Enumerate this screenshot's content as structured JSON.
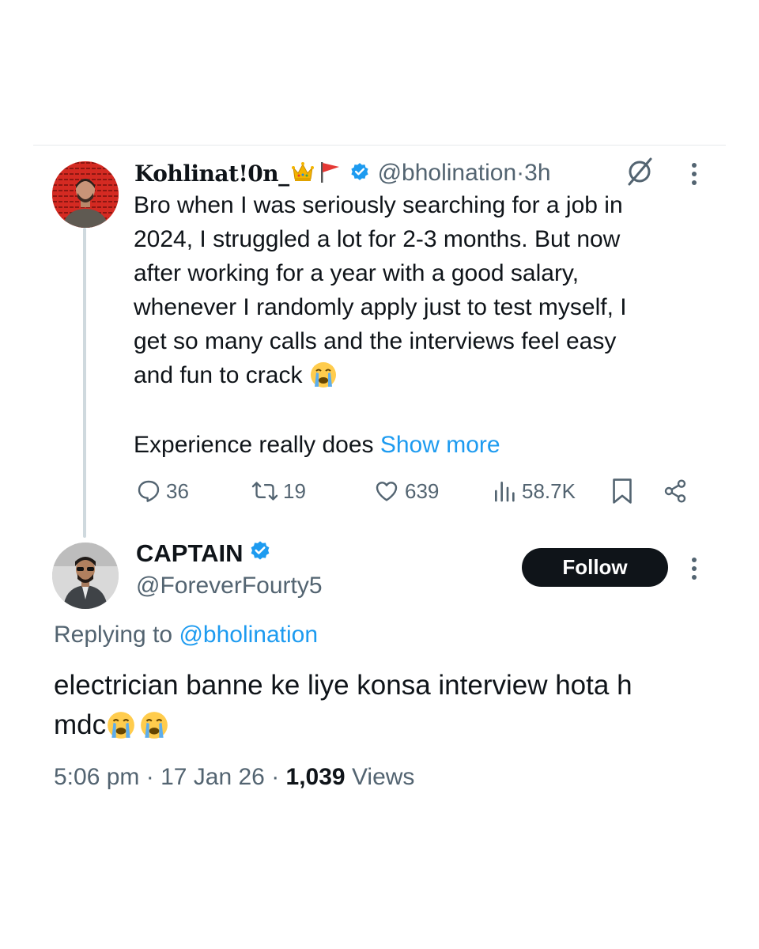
{
  "tweet": {
    "author_name": "Kohlinat!0n_",
    "author_emojis": [
      "crown-emoji",
      "red-flag-emoji"
    ],
    "handle": "@bholination",
    "time_sep": " · ",
    "time": "3h",
    "body_lines": [
      "Bro when I was seriously searching for a job in",
      "2024, I struggled a lot for 2-3 months. But now",
      "after working for a year with a good salary,",
      "whenever I randomly apply just to test myself, I",
      "get so many calls and the interviews feel easy",
      "and fun to crack"
    ],
    "body_last": "Experience really does ",
    "show_more": "Show more",
    "stats": {
      "replies": "36",
      "reposts": "19",
      "likes": "639",
      "views": "58.7K"
    }
  },
  "reply": {
    "author_name": "CAPTAIN",
    "handle": "@ForeverFourty5",
    "follow_label": "Follow",
    "replying_prefix": "Replying to ",
    "replying_to": "@bholination",
    "body_line1": "electrician banne ke liye konsa interview hota h",
    "body_line2": "mdc",
    "time": "5:06 pm",
    "date": "17 Jan 26",
    "sep": " · ",
    "views_count": "1,039",
    "views_label": " Views"
  },
  "colors": {
    "verified": "#1d9bf0",
    "link": "#1d9bf0",
    "secondary_text": "#536471",
    "primary_text": "#0f1419",
    "follow_bg": "#0f1419"
  }
}
